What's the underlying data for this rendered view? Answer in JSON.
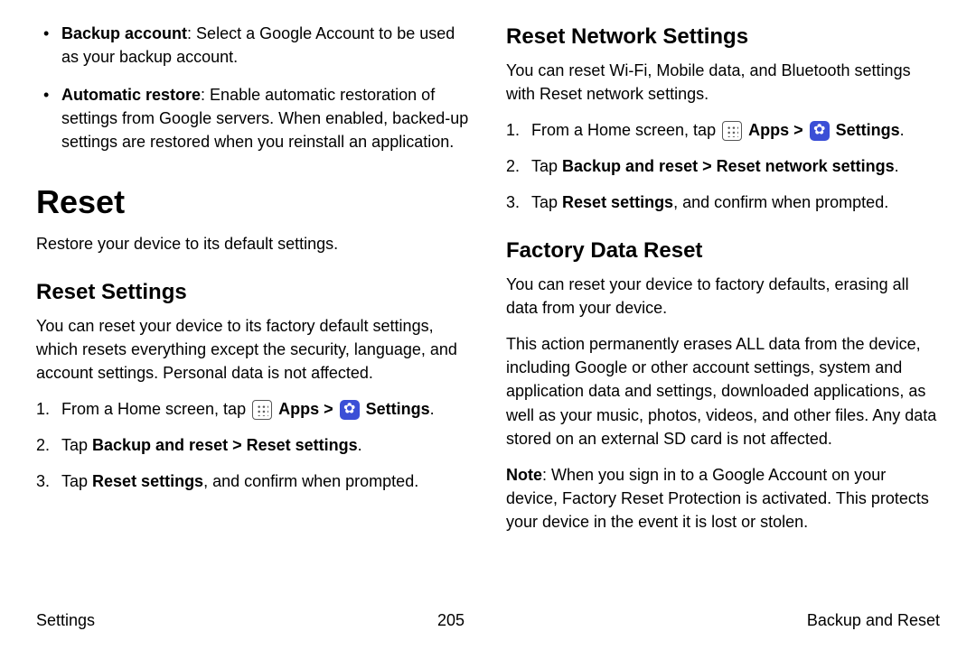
{
  "left": {
    "bullets": [
      {
        "term": "Backup account",
        "desc": ": Select a Google Account to be used as your backup account."
      },
      {
        "term": "Automatic restore",
        "desc": ": Enable automatic restoration of settings from Google servers. When enabled, backed-up settings are restored when you reinstall an application."
      }
    ],
    "h1": "Reset",
    "h1_sub": "Restore your device to its default settings.",
    "h2": "Reset Settings",
    "h2_p": "You can reset your device to its factory default settings, which resets everything except the security, language, and account settings. Personal data is not affected.",
    "steps": {
      "s1_pre": "From a Home screen, tap ",
      "apps": "Apps",
      "gt": ">",
      "settings": "Settings",
      "period": ".",
      "s2_pre": "Tap ",
      "s2_bold": "Backup and reset > Reset settings",
      "s3_pre": "Tap ",
      "s3_bold": "Reset settings",
      "s3_post": ", and confirm when prompted."
    }
  },
  "right": {
    "h2a": "Reset Network Settings",
    "h2a_p": "You can reset Wi-Fi, Mobile data, and Bluetooth settings with Reset network settings.",
    "steps_a": {
      "s1_pre": "From a Home screen, tap ",
      "apps": "Apps",
      "gt": ">",
      "settings": "Settings",
      "period": ".",
      "s2_pre": "Tap ",
      "s2_bold": "Backup and reset > Reset network settings",
      "s3_pre": "Tap ",
      "s3_bold": "Reset settings",
      "s3_post": ", and confirm when prompted."
    },
    "h2b": "Factory Data Reset",
    "h2b_p1": "You can reset your device to factory defaults, erasing all data from your device.",
    "h2b_p2": "This action permanently erases ALL data from the device, including Google or other account settings, system and application data and settings, downloaded applications, as well as your music, photos, videos, and other files. Any data stored on an external SD card is not affected.",
    "note_label": "Note",
    "note_body": ": When you sign in to a Google Account on your device, Factory Reset Protection is activated. This protects your device in the event it is lost or stolen."
  },
  "footer": {
    "left": "Settings",
    "center": "205",
    "right": "Backup and Reset"
  }
}
